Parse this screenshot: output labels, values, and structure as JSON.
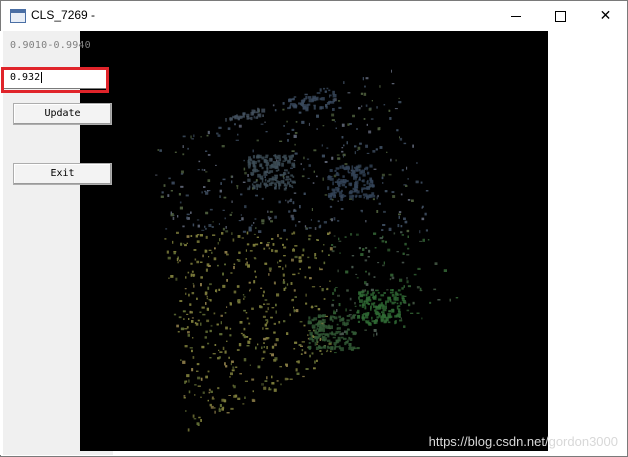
{
  "window": {
    "title": "CLS_7269 -",
    "controls": {
      "minimize": "minimize",
      "maximize": "maximize",
      "close": "✕"
    }
  },
  "panel": {
    "range_label": "0.9010-0.9940",
    "input_value": "0.932",
    "update_label": "Update",
    "exit_label": "Exit"
  },
  "image": {
    "description_colors": {
      "background": "#000000",
      "vegetation": "#6a7a40",
      "water": "#3c5064",
      "forest": "#2e5a2e"
    }
  },
  "watermark": "https://blog.csdn.net/gordon3000",
  "accent": {
    "highlight": "#e0242a"
  }
}
